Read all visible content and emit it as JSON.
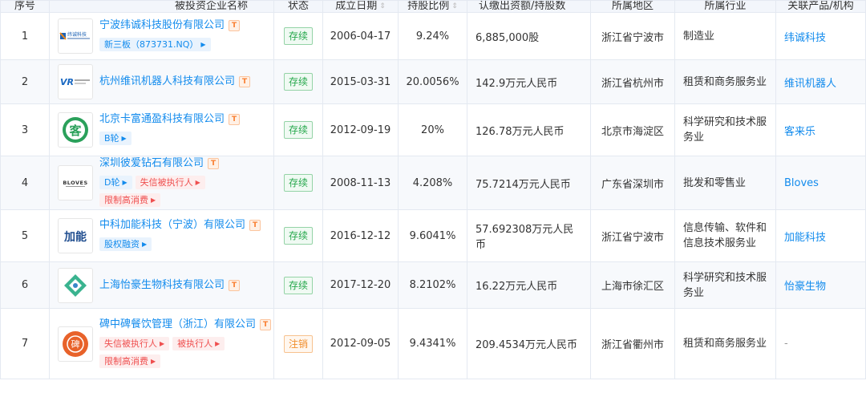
{
  "columns": {
    "index": "序号",
    "company": "被投资企业名称",
    "status": "状态",
    "founded": "成立日期",
    "ratio": "持股比例",
    "capital": "认缴出资额/持股数",
    "region": "所属地区",
    "industry": "所属行业",
    "product": "关联产品/机构"
  },
  "sort_icon": "sort-arrows-icon",
  "colors": {
    "link": "#128bed",
    "status_active": "#26a84c",
    "status_cancel": "#f08e2c",
    "risk_red": "#ef4f4f",
    "header_bg": "#f3f6fb"
  },
  "rows": [
    {
      "index": "1",
      "logo": "weicheng-logo",
      "logo_text": "纬诚科技",
      "company": "宁波纬诚科技股份有限公司",
      "tags": [
        {
          "text": "新三板（873731.NQ）",
          "type": "blue"
        }
      ],
      "status": "存续",
      "founded": "2006-04-17",
      "ratio": "9.24%",
      "capital": "6,885,000股",
      "region": "浙江省宁波市",
      "industry": "制造业",
      "product": "纬诚科技"
    },
    {
      "index": "2",
      "logo": "weixun-robot-logo",
      "logo_text": "VR",
      "company": "杭州维讯机器人科技有限公司",
      "tags": [],
      "status": "存续",
      "founded": "2015-03-31",
      "ratio": "20.0056%",
      "capital": "142.9万元人民币",
      "region": "浙江省杭州市",
      "industry": "租赁和商务服务业",
      "product": "维讯机器人"
    },
    {
      "index": "3",
      "logo": "kelaile-logo",
      "logo_text": "客",
      "company": "北京卡富通盈科技有限公司",
      "tags": [
        {
          "text": "B轮",
          "type": "blue"
        }
      ],
      "status": "存续",
      "founded": "2012-09-19",
      "ratio": "20%",
      "capital": "126.78万元人民币",
      "region": "北京市海淀区",
      "industry": "科学研究和技术服务业",
      "product": "客来乐"
    },
    {
      "index": "4",
      "logo": "bloves-logo",
      "logo_text": "BLOVES",
      "company": "深圳彼爱钻石有限公司",
      "tags": [
        {
          "text": "D轮",
          "type": "blue"
        },
        {
          "text": "失信被执行人",
          "type": "red"
        },
        {
          "text": "限制高消费",
          "type": "red"
        }
      ],
      "status": "存续",
      "founded": "2008-11-13",
      "ratio": "4.208%",
      "capital": "75.7214万元人民币",
      "region": "广东省深圳市",
      "industry": "批发和零售业",
      "product": "Bloves"
    },
    {
      "index": "5",
      "logo": "jianeng-logo",
      "logo_text": "加能",
      "company": "中科加能科技（宁波）有限公司",
      "tags": [
        {
          "text": "股权融资",
          "type": "blue"
        }
      ],
      "status": "存续",
      "founded": "2016-12-12",
      "ratio": "9.6041%",
      "capital": "57.692308万元人民币",
      "region": "浙江省宁波市",
      "industry": "信息传输、软件和信息技术服务业",
      "product": "加能科技"
    },
    {
      "index": "6",
      "logo": "yihao-logo",
      "logo_text": "",
      "company": "上海怡豪生物科技有限公司",
      "tags": [],
      "status": "存续",
      "founded": "2017-12-20",
      "ratio": "8.2102%",
      "capital": "16.22万元人民币",
      "region": "上海市徐汇区",
      "industry": "科学研究和技术服务业",
      "product": "怡豪生物"
    },
    {
      "index": "7",
      "logo": "beizhongbei-logo",
      "logo_text": "碑",
      "company": "碑中碑餐饮管理（浙江）有限公司",
      "tags": [
        {
          "text": "失信被执行人",
          "type": "red"
        },
        {
          "text": "被执行人",
          "type": "red"
        },
        {
          "text": "限制高消费",
          "type": "red"
        }
      ],
      "status": "注销",
      "founded": "2012-09-05",
      "ratio": "9.4341%",
      "capital": "209.4534万元人民币",
      "region": "浙江省衢州市",
      "industry": "租赁和商务服务业",
      "product": "-"
    }
  ]
}
